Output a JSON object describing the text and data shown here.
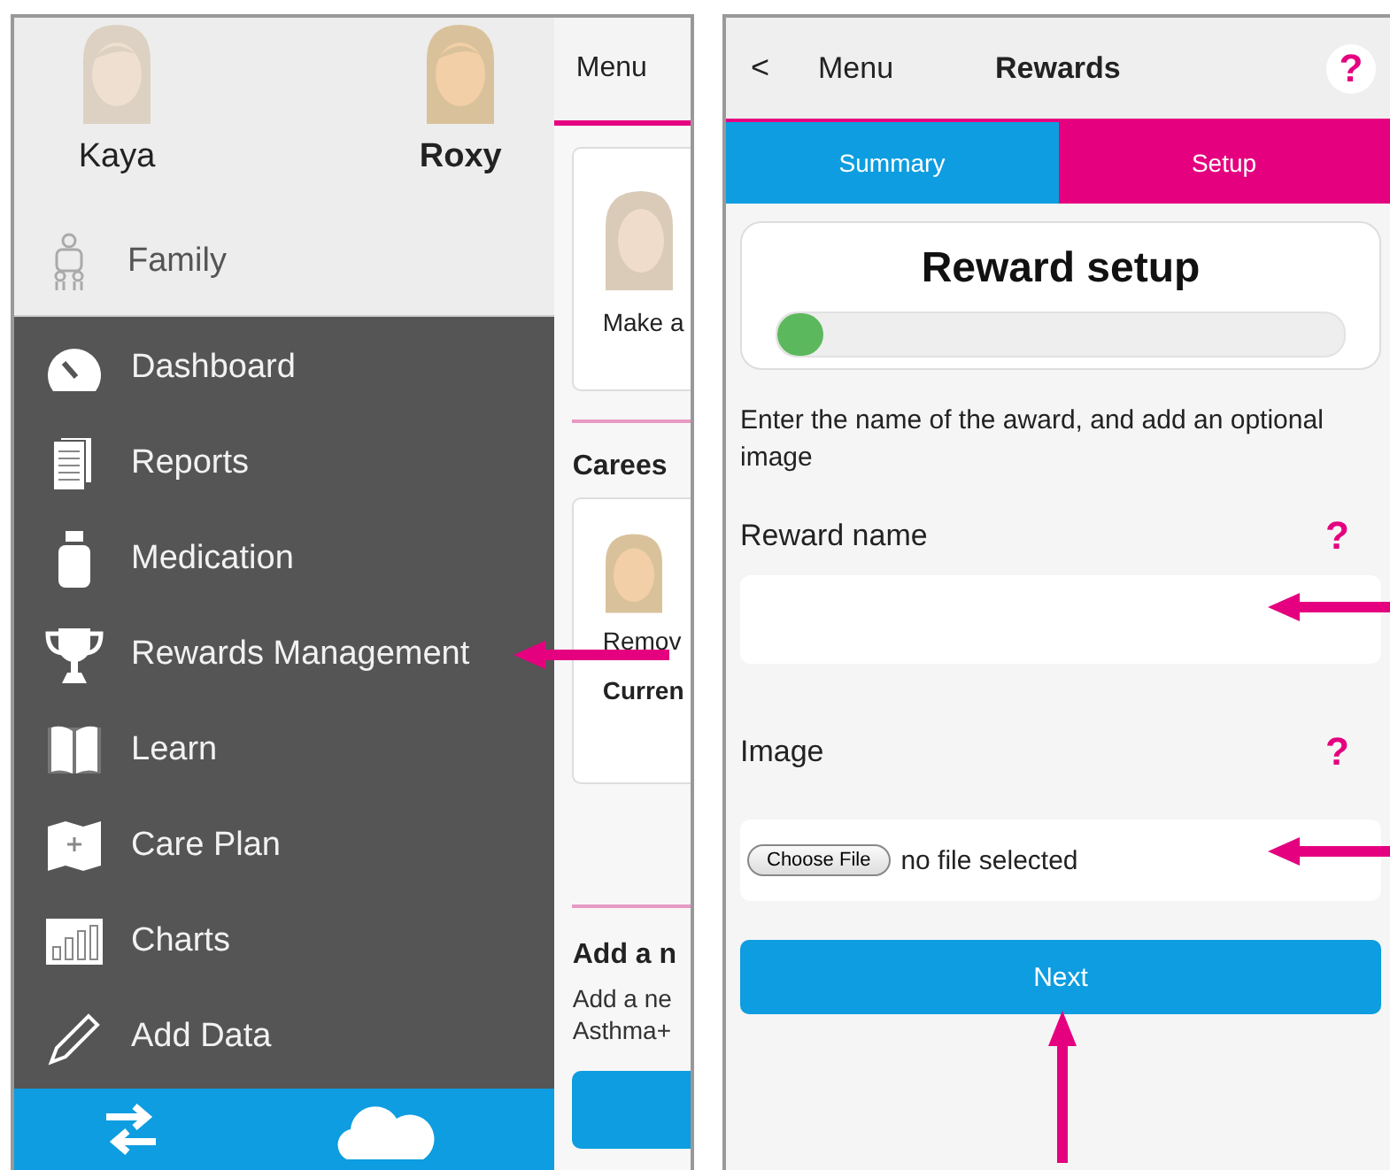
{
  "left_screen": {
    "profiles": [
      {
        "name": "Kaya",
        "selected": false
      },
      {
        "name": "Roxy",
        "selected": true
      }
    ],
    "family": {
      "label": "Family"
    },
    "menu_items": [
      {
        "label": "Dashboard",
        "kind": "dashboard",
        "marked": false
      },
      {
        "label": "Reports",
        "kind": "reports",
        "marked": false
      },
      {
        "label": "Medication",
        "kind": "medication",
        "marked": false
      },
      {
        "label": "Rewards Management",
        "kind": "rewards",
        "marked": true
      },
      {
        "label": "Learn",
        "kind": "learn",
        "marked": false
      },
      {
        "label": "Care Plan",
        "kind": "careplan",
        "marked": false
      },
      {
        "label": "Charts",
        "kind": "charts",
        "marked": false
      },
      {
        "label": "Add Data",
        "kind": "adddata",
        "marked": false
      }
    ],
    "behind_panel": {
      "title": "Menu",
      "card_1_text": "Make a",
      "section_heading": "Carees",
      "card_2_line_1": "Remov",
      "card_2_line_2": "Curren",
      "add_heading": "Add a n",
      "add_text_1": "Add a ne",
      "add_text_2": "Asthma+"
    }
  },
  "right_screen": {
    "header": {
      "back": "<",
      "back_label": "Menu",
      "title": "Rewards",
      "help": "?"
    },
    "tabs": [
      {
        "label": "Summary",
        "selected": false
      },
      {
        "label": "Setup",
        "selected": true
      }
    ],
    "setup_card": {
      "title": "Reward setup",
      "level": 0.05
    },
    "instructions": "Enter the name of the award, and add an optional image",
    "reward_name": {
      "label": "Reward name",
      "help": "?",
      "marked": true
    },
    "image": {
      "label": "Image",
      "help": "?",
      "button": "Choose File",
      "status": "no file selected",
      "marked": true
    },
    "next_button": {
      "label": "Next",
      "marked": true
    }
  }
}
